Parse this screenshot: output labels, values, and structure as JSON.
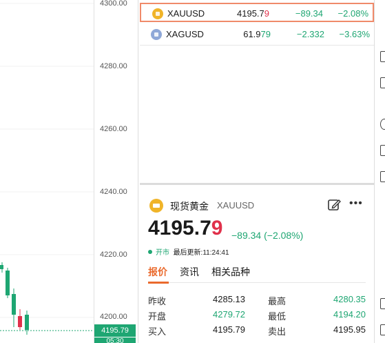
{
  "chart": {
    "y_ticks": [
      "4300.00",
      "4280.00",
      "4260.00",
      "4240.00",
      "4220.00",
      "4200.00"
    ],
    "last_price": "4195.79",
    "last_price_sub": "05:30",
    "colors": {
      "up": "#1ea672",
      "down": "#e0314b"
    }
  },
  "watchlist": {
    "rows": [
      {
        "symbol": "XAUUSD",
        "price_main": "4195.7",
        "price_tail": "9",
        "change": "−89.34",
        "change_pct": "−2.08%",
        "icon": "gold-coin-icon"
      },
      {
        "symbol": "XAGUSD",
        "price_main": "61.9",
        "price_tail": "79",
        "change": "−2.332",
        "change_pct": "−3.63%",
        "icon": "silver-coin-icon"
      }
    ]
  },
  "detail": {
    "name": "现货黄金",
    "symbol": "XAUUSD",
    "price_main": "4195.7",
    "price_tail": "9",
    "change": "−89.34 (−2.08%)",
    "status": "开市",
    "updated": "最后更新:11:24:41",
    "tabs": [
      "报价",
      "资讯",
      "相关品种"
    ],
    "quotes": [
      {
        "l1": "昨收",
        "v1": "4285.13",
        "l2": "最高",
        "v2": "4280.35"
      },
      {
        "l1": "开盘",
        "v1": "4279.72",
        "l2": "最低",
        "v2": "4194.20"
      },
      {
        "l1": "买入",
        "v1": "4195.79",
        "l2": "卖出",
        "v2": "4195.95"
      }
    ]
  }
}
